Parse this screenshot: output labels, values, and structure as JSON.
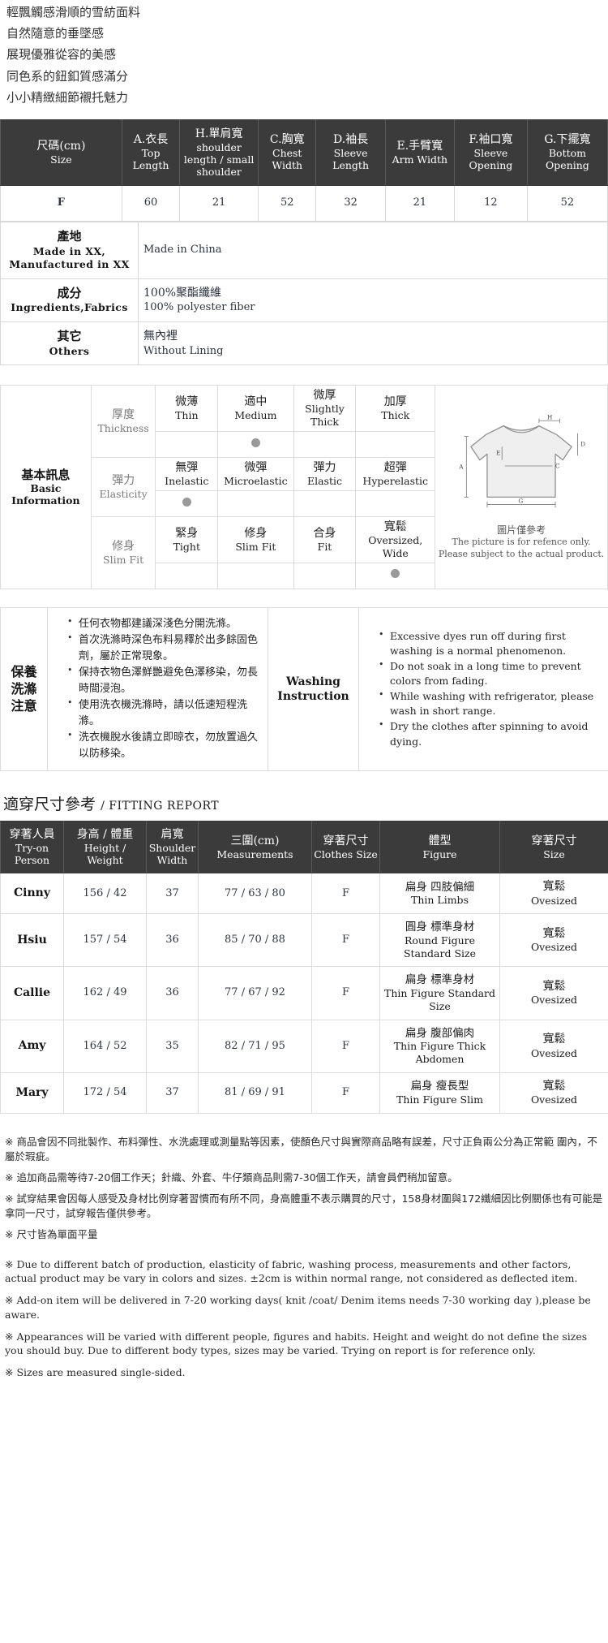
{
  "intro": {
    "lines": [
      "輕飄觸感滑順的雪紡面料",
      "自然隨意的垂墜感",
      "展現優雅從容的美感",
      "同色系的鈕釦質感滿分",
      "小小精緻細節襯托魅力"
    ]
  },
  "size_table": {
    "headers": [
      {
        "cn": "尺碼(cm)",
        "en": "Size"
      },
      {
        "cn": "A.衣長",
        "en": "Top Length"
      },
      {
        "cn": "H.單肩寬",
        "en": "shoulder length / small shoulder"
      },
      {
        "cn": "C.胸寬",
        "en": "Chest Width"
      },
      {
        "cn": "D.袖長",
        "en": "Sleeve Length"
      },
      {
        "cn": "E.手臂寬",
        "en": "Arm Width"
      },
      {
        "cn": "F.袖口寬",
        "en": "Sleeve Opening"
      },
      {
        "cn": "G.下擺寬",
        "en": "Bottom Opening"
      }
    ],
    "rows": [
      [
        "F",
        "60",
        "21",
        "52",
        "32",
        "21",
        "12",
        "52"
      ]
    ]
  },
  "info_rows": [
    {
      "label_cn": "產地",
      "label_en": "Made in XX, Manufactured in XX",
      "value_cn": "",
      "value_en": "Made in China"
    },
    {
      "label_cn": "成分",
      "label_en": "Ingredients,Fabrics",
      "value_cn": "100%聚酯纖維",
      "value_en": "100% polyester fiber"
    },
    {
      "label_cn": "其它",
      "label_en": "Others",
      "value_cn": "無內裡",
      "value_en": "Without Lining"
    }
  ],
  "basic_info": {
    "title_cn": "基本訊息",
    "title_en": "Basic Information",
    "attributes": [
      {
        "name_cn": "厚度",
        "name_en": "Thickness",
        "options": [
          {
            "cn": "微薄",
            "en": "Thin",
            "selected": false
          },
          {
            "cn": "適中",
            "en": "Medium",
            "selected": true
          },
          {
            "cn": "微厚",
            "en": "Slightly Thick",
            "selected": false
          },
          {
            "cn": "加厚",
            "en": "Thick",
            "selected": false
          }
        ]
      },
      {
        "name_cn": "彈力",
        "name_en": "Elasticity",
        "options": [
          {
            "cn": "無彈",
            "en": "Inelastic",
            "selected": true
          },
          {
            "cn": "微彈",
            "en": "Microelastic",
            "selected": false
          },
          {
            "cn": "彈力",
            "en": "Elastic",
            "selected": false
          },
          {
            "cn": "超彈",
            "en": "Hyperelastic",
            "selected": false
          }
        ]
      },
      {
        "name_cn": "修身",
        "name_en": "Slim Fit",
        "options": [
          {
            "cn": "緊身",
            "en": "Tight",
            "selected": false
          },
          {
            "cn": "修身",
            "en": "Slim Fit",
            "selected": false
          },
          {
            "cn": "合身",
            "en": "Fit",
            "selected": false
          },
          {
            "cn": "寬鬆",
            "en": "Oversized, Wide",
            "selected": true
          }
        ]
      }
    ],
    "diagram": {
      "labels": [
        "A",
        "C",
        "D",
        "E",
        "G",
        "H"
      ],
      "note_cn": "圖片僅參考",
      "note_en": "The picture is for refence only. Please subject to the actual product."
    }
  },
  "washing": {
    "label_cn": "保養洗滌注意",
    "label_en": "Washing Instruction",
    "items_cn": [
      "任何衣物都建議深淺色分開洗滌。",
      "首次洗滌時深色布料易釋於出多餘固色劑，屬於正常現象。",
      "保持衣物色澤鮮艷避免色澤移染，勿長時間浸泡。",
      "使用洗衣機洗滌時，請以低速短程洗滌。",
      "洗衣機脫水後請立即晾衣，勿放置過久以防移染。"
    ],
    "items_en": [
      "Excessive dyes run off during first washing is a normal phenomenon.",
      "Do not soak in a long time to prevent colors from fading.",
      "While washing with refrigerator, please wash in short range.",
      "Dry the clothes after spinning to avoid dying."
    ]
  },
  "fitting_report": {
    "title_cn": "適穿尺寸參考",
    "title_en": "/ FITTING REPORT",
    "headers": [
      {
        "cn": "穿著人員",
        "en": "Try-on Person"
      },
      {
        "cn": "身高 / 體重",
        "en": "Height / Weight"
      },
      {
        "cn": "肩寬",
        "en": "Shoulder Width"
      },
      {
        "cn": "三圍(cm)",
        "en": "Measurements"
      },
      {
        "cn": "穿著尺寸",
        "en": "Clothes Size"
      },
      {
        "cn": "體型",
        "en": "Figure"
      },
      {
        "cn": "穿著尺寸",
        "en": "Size"
      }
    ],
    "rows": [
      {
        "person": "Cinny",
        "height_weight": "156 / 42",
        "shoulder": "37",
        "measurements": "77 / 63 / 80",
        "clothes_size": "F",
        "figure_cn": "扁身 四肢偏細",
        "figure_en": "Thin Limbs",
        "size_cn": "寬鬆",
        "size_en": "Ovesized"
      },
      {
        "person": "Hsiu",
        "height_weight": "157 / 54",
        "shoulder": "36",
        "measurements": "85 / 70 / 88",
        "clothes_size": "F",
        "figure_cn": "圓身 標準身材",
        "figure_en": "Round Figure Standard Size",
        "size_cn": "寬鬆",
        "size_en": "Ovesized"
      },
      {
        "person": "Callie",
        "height_weight": "162 / 49",
        "shoulder": "36",
        "measurements": "77 / 67 / 92",
        "clothes_size": "F",
        "figure_cn": "扁身 標準身材",
        "figure_en": "Thin Figure Standard Size",
        "size_cn": "寬鬆",
        "size_en": "Ovesized"
      },
      {
        "person": "Amy",
        "height_weight": "164 / 52",
        "shoulder": "35",
        "measurements": "82 / 71 / 95",
        "clothes_size": "F",
        "figure_cn": "扁身 腹部偏肉",
        "figure_en": "Thin Figure Thick Abdomen",
        "size_cn": "寬鬆",
        "size_en": "Ovesized"
      },
      {
        "person": "Mary",
        "height_weight": "172 / 54",
        "shoulder": "37",
        "measurements": "81 / 69 / 91",
        "clothes_size": "F",
        "figure_cn": "扁身 瘦長型",
        "figure_en": "Thin Figure Slim",
        "size_cn": "寬鬆",
        "size_en": "Ovesized"
      }
    ]
  },
  "notes": {
    "cn": [
      "※ 商品會因不同批製作、布料彈性、水洗處理或測量點等因素，使顏色尺寸與實際商品略有誤差，尺寸正負兩公分為正常範 圍內，不屬於瑕疵。",
      "※ 追加商品需等待7-20個工作天；針織、外套、牛仔類商品則需7-30個工作天，請會員們稍加留意。",
      "※ 試穿結果會因每人感受及身材比例穿著習慣而有所不同，身高體重不表示購買的尺寸，158身材圍與172纖細因比例關係也有可能是拿同一尺寸，試穿報告僅供參考。",
      "※ 尺寸皆為單面平量"
    ],
    "en": [
      "※ Due to different batch of production, elasticity of fabric, washing process, measurements and other factors, actual product may be vary in colors and sizes. ±2cm is within normal range, not considered as deflected item.",
      "※ Add-on item will be delivered in 7-20 working days( knit /coat/ Denim items needs 7-30 working day ),please be aware.",
      "※ Appearances will be varied with different people, figures and habits. Height and weight do not define the sizes you should buy. Due to different body types, sizes may be varied. Trying on report is for reference only.",
      "※ Sizes are measured single-sided."
    ]
  },
  "colors": {
    "header_bg": "#3b3b3b",
    "header_text": "#ffffff",
    "border": "#dcdcdc",
    "dot": "#9a9a9a",
    "body_text": "#2c3440"
  }
}
